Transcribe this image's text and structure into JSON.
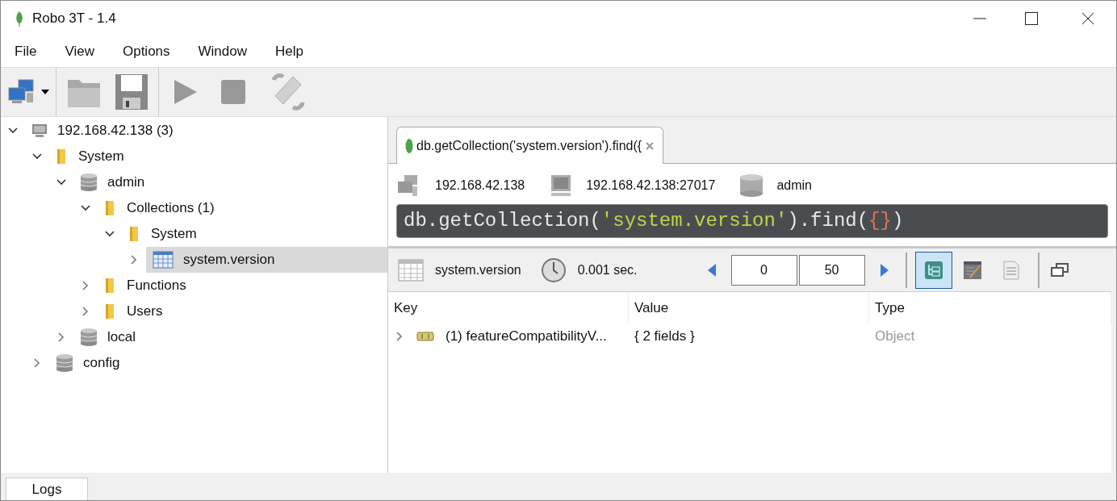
{
  "window": {
    "title": "Robo 3T - 1.4"
  },
  "menu": [
    "File",
    "View",
    "Options",
    "Window",
    "Help"
  ],
  "tree": [
    {
      "label": "192.168.42.138 (3)",
      "kind": "server",
      "expanded": true,
      "selected": false,
      "children": [
        {
          "label": "System",
          "kind": "folder",
          "expanded": true,
          "selected": false,
          "children": [
            {
              "label": "admin",
              "kind": "database",
              "expanded": true,
              "selected": false,
              "children": [
                {
                  "label": "Collections (1)",
                  "kind": "folder",
                  "expanded": true,
                  "selected": false,
                  "children": [
                    {
                      "label": "System",
                      "kind": "folder",
                      "expanded": true,
                      "selected": false,
                      "children": [
                        {
                          "label": "system.version",
                          "kind": "collection",
                          "expanded": false,
                          "selected": true
                        }
                      ]
                    }
                  ]
                },
                {
                  "label": "Functions",
                  "kind": "folder",
                  "expanded": false,
                  "selected": false
                },
                {
                  "label": "Users",
                  "kind": "folder",
                  "expanded": false,
                  "selected": false
                }
              ]
            },
            {
              "label": "local",
              "kind": "database",
              "expanded": false,
              "selected": false
            }
          ]
        },
        {
          "label": "config",
          "kind": "database",
          "expanded": false,
          "selected": false
        }
      ]
    }
  ],
  "tabs": [
    {
      "label": "db.getCollection('system.version').find({",
      "selected": true
    }
  ],
  "connection": {
    "server": "192.168.42.138",
    "host": "192.168.42.138:27017",
    "database": "admin"
  },
  "query": [
    {
      "text": "db.getCollection(",
      "color": "#e8e8e8"
    },
    {
      "text": "'system.version'",
      "color": "#b8d84a"
    },
    {
      "text": ").find(",
      "color": "#e8e8e8"
    },
    {
      "text": "{}",
      "color": "#e0705a"
    },
    {
      "text": ")",
      "color": "#e8e8e8"
    }
  ],
  "results_bar": {
    "collection": "system.version",
    "time": "0.001 sec.",
    "skip": "0",
    "limit": "50",
    "views": [
      {
        "kind": "tree",
        "selected": true
      },
      {
        "kind": "table",
        "selected": false
      },
      {
        "kind": "text",
        "selected": false
      }
    ]
  },
  "table": {
    "columns": [
      "Key",
      "Value",
      "Type"
    ],
    "rows": [
      {
        "key": "(1) featureCompatibilityV...",
        "value": "{ 2 fields }",
        "type": "Object",
        "expanded": false
      }
    ]
  },
  "bottom_tabs": [
    "Logs"
  ]
}
